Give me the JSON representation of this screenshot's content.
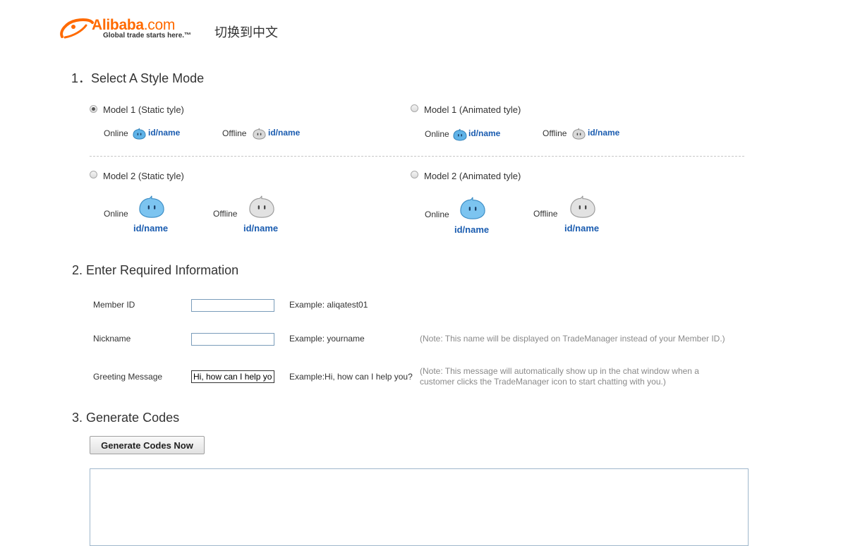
{
  "header": {
    "logo": {
      "brand": "Alibaba",
      "domain": ".com",
      "tagline": "Global trade starts here.™"
    },
    "language_switch": "切换到中文"
  },
  "section1": {
    "title": "1．Select A Style Mode",
    "options": [
      {
        "label": "Model 1 (Static tyle)",
        "selected": true,
        "online_label": "Online",
        "offline_label": "Offline",
        "id_text": "id/name"
      },
      {
        "label": "Model 1 (Animated tyle)",
        "selected": false,
        "online_label": "Online",
        "offline_label": "Offline",
        "id_text": "id/name"
      },
      {
        "label": "Model 2 (Static tyle)",
        "selected": false,
        "online_label": "Online",
        "offline_label": "Offline",
        "id_text": "id/name"
      },
      {
        "label": "Model 2 (Animated tyle)",
        "selected": false,
        "online_label": "Online",
        "offline_label": "Offline",
        "id_text": "id/name"
      }
    ]
  },
  "section2": {
    "title": "2. Enter Required Information",
    "member_id": {
      "label": "Member ID",
      "value": "",
      "example": "Example: aliqatest01"
    },
    "nickname": {
      "label": "Nickname",
      "value": "",
      "example": "Example: yourname",
      "note": "(Note: This name will be displayed on TradeManager instead of your Member ID.)"
    },
    "greeting": {
      "label": "Greeting Message",
      "value": "Hi, how can I help you?",
      "example": "Example:Hi, how can I help you?",
      "note": "(Note: This message will automatically show up in the chat window when a customer clicks the TradeManager icon to start chatting with you.)"
    }
  },
  "section3": {
    "title": "3. Generate Codes",
    "button_label": "Generate Codes Now",
    "output_value": ""
  },
  "colors": {
    "brand_orange": "#ff6a00",
    "link_blue": "#1a5cb0",
    "online_icon": "#5fb3e8",
    "offline_icon": "#c4c4c4"
  },
  "icons": [
    "alibaba-logo",
    "online-status-icon",
    "offline-status-icon"
  ]
}
